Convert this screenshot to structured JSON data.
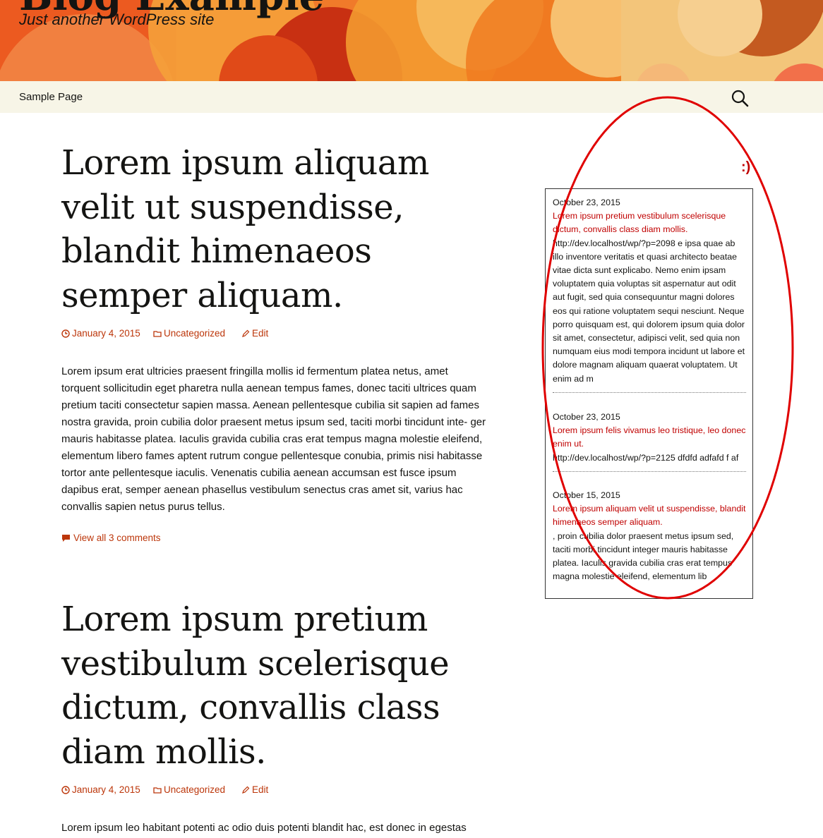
{
  "site": {
    "title": "Blog Example",
    "description": "Just another WordPress site"
  },
  "nav": {
    "items": [
      "Sample Page"
    ],
    "search_icon": "search-icon"
  },
  "posts": [
    {
      "title": "Lorem ipsum aliquam velit ut suspendisse, blandit himenaeos semper aliquam.",
      "date": "January 4, 2015",
      "category": "Uncategorized",
      "edit": "Edit",
      "content": "Lorem ipsum erat ultricies praesent fringilla mollis id fermentum platea netus, amet torquent sollicitudin eget pharetra nulla aenean tempus fames, donec taciti ultrices quam pretium taciti consectetur sapien massa. Aenean pellentesque cubilia sit sapien ad fames nostra gravida, proin cubilia dolor praesent metus ipsum sed, taciti morbi tincidunt inte- ger mauris habitasse platea. Iaculis gravida cubilia cras erat tempus magna molestie eleifend, elementum libero fames aptent rutrum congue pellentesque conubia, primis nisi habitasse tortor ante pellentesque iaculis. Venenatis cubilia aenean accumsan est fusce ipsum dapibus erat, semper aenean phasellus vestibulum senectus cras amet sit, varius hac convallis sapien netus purus tellus.",
      "comments": "View all 3 comments"
    },
    {
      "title": "Lorem ipsum pretium vestibulum scelerisque dictum, convallis class diam mollis.",
      "date": "January 4, 2015",
      "category": "Uncategorized",
      "edit": "Edit",
      "content": "Lorem ipsum leo habitant potenti ac odio duis potenti blandit hac, est donec in egestas torquent molestie leo fames lacus a, risus donec neque sociosqu cras etiam senectus nisl"
    }
  ],
  "widget": {
    "title": ":)",
    "posts": [
      {
        "date": "October 23, 2015",
        "title": "Lorem ipsum pretium vestibulum scelerisque dictum, convallis class diam mollis.",
        "excerpt": "http://dev.localhost/wp/?p=2098 e ipsa quae ab illo inventore veritatis et quasi architecto beatae vitae dicta sunt explicabo. Nemo enim ipsam voluptatem quia voluptas sit aspernatur aut odit aut fugit, sed quia consequuntur magni dolores eos qui ratione voluptatem sequi nesciunt. Neque porro quisquam est, qui dolorem ipsum quia dolor sit amet, consectetur, adipisci velit, sed quia non numquam eius modi tempora incidunt ut labore et dolore magnam aliquam quaerat voluptatem. Ut enim ad m"
      },
      {
        "date": "October 23, 2015",
        "title": "Lorem ipsum felis vivamus leo tristique, leo donec enim ut.",
        "excerpt": "http://dev.localhost/wp/?p=2125 dfdfd adfafd f af"
      },
      {
        "date": "October 15, 2015",
        "title": "Lorem ipsum aliquam velit ut suspendisse, blandit himenaeos semper aliquam.",
        "excerpt": ", proin cubilia dolor praesent metus ipsum sed, taciti morbi tincidunt integer mauris habitasse platea. Iaculis gravida cubilia cras erat tempus magna molestie eleifend, elementum lib"
      }
    ]
  },
  "colors": {
    "link": "#bc360a",
    "widget_link": "#c00000",
    "nav_bg": "#f7f5e7",
    "annotation": "#e00000"
  }
}
